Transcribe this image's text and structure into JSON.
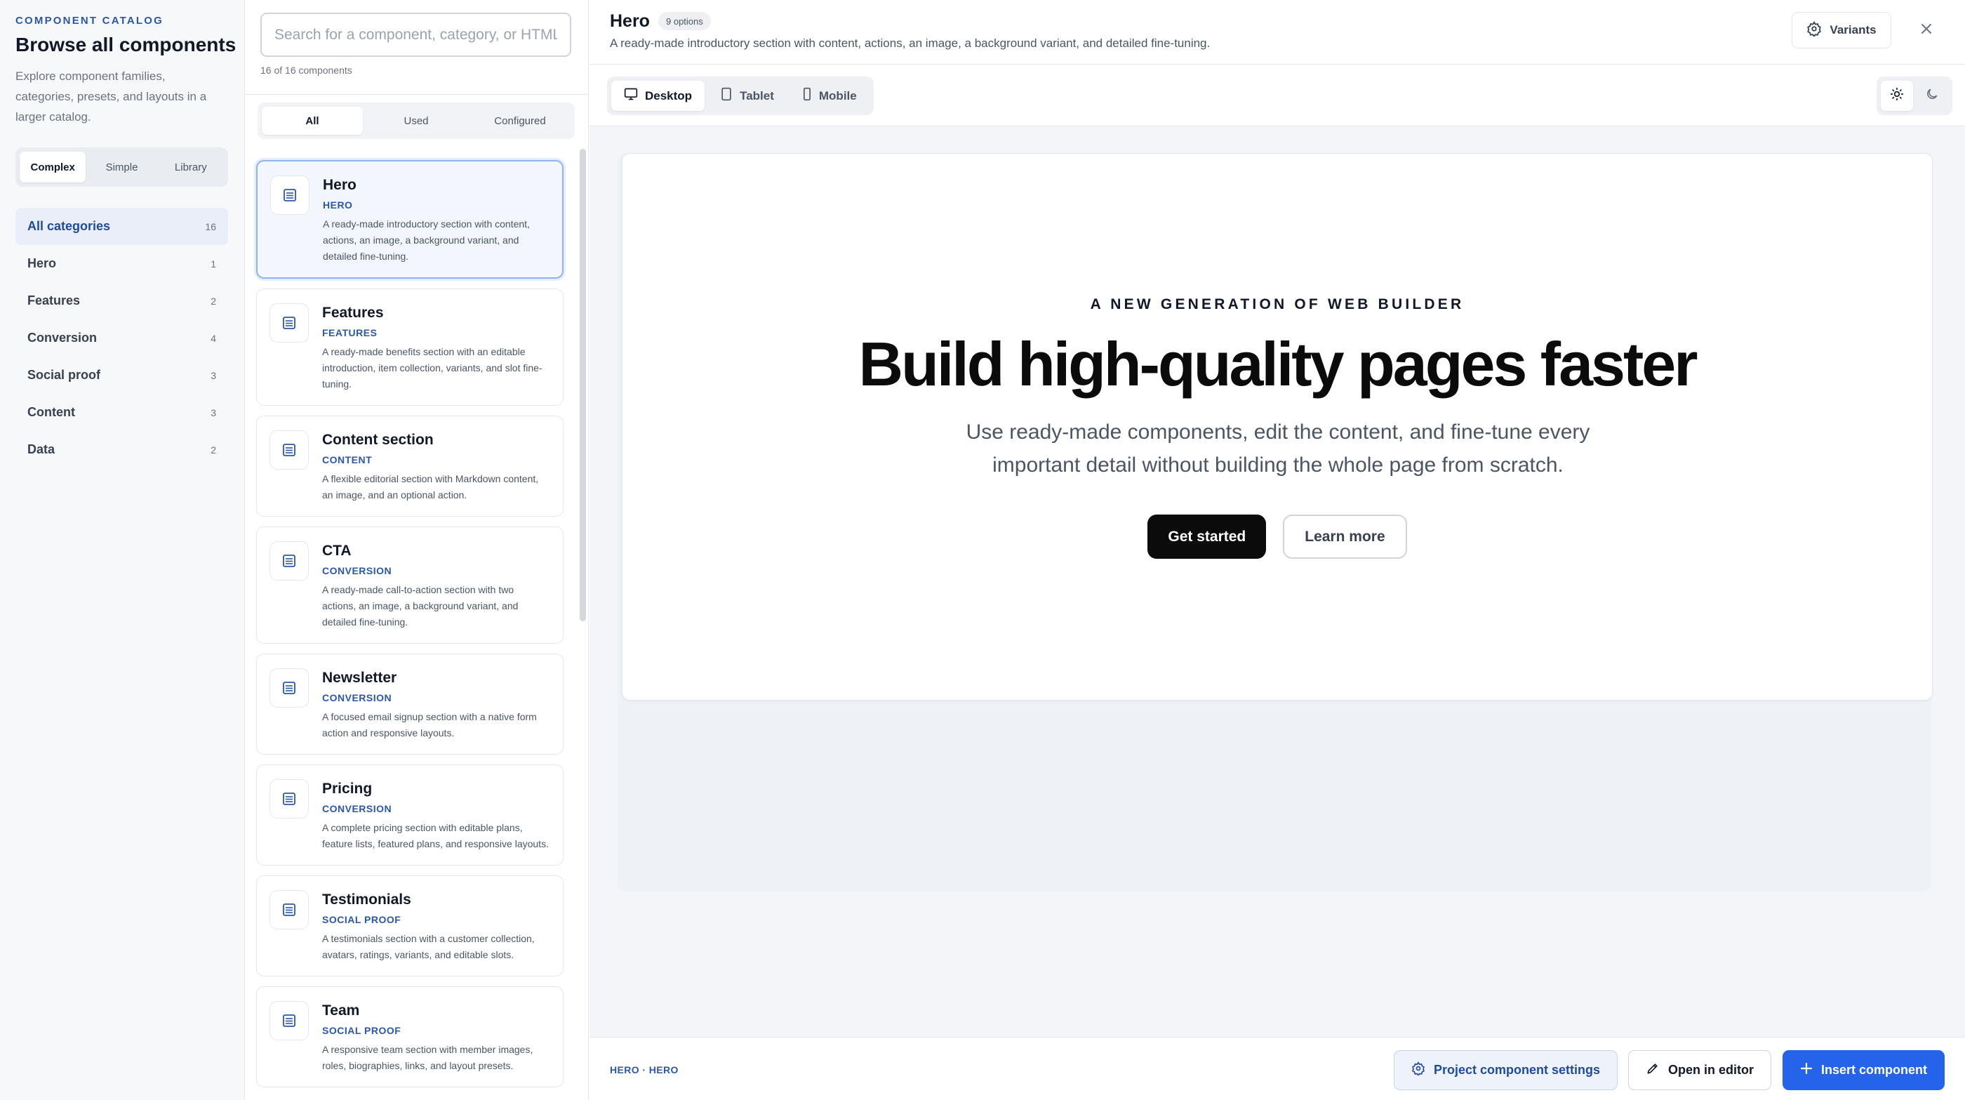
{
  "sidebar": {
    "eyebrow": "COMPONENT CATALOG",
    "title": "Browse all components",
    "description": "Explore component families, categories, presets, and layouts in a larger catalog.",
    "modes": [
      "Complex",
      "Simple",
      "Library"
    ],
    "active_mode": "Complex",
    "categories": [
      {
        "label": "All categories",
        "count": "16",
        "active": true
      },
      {
        "label": "Hero",
        "count": "1"
      },
      {
        "label": "Features",
        "count": "2"
      },
      {
        "label": "Conversion",
        "count": "4"
      },
      {
        "label": "Social proof",
        "count": "3"
      },
      {
        "label": "Content",
        "count": "3"
      },
      {
        "label": "Data",
        "count": "2"
      }
    ]
  },
  "list": {
    "search_placeholder": "Search for a component, category, or HTML tag",
    "search_value": "",
    "count_text": "16 of 16 components",
    "filters": [
      "All",
      "Used",
      "Configured"
    ],
    "active_filter": "All",
    "components": [
      {
        "name": "Hero",
        "tag": "HERO",
        "desc": "A ready-made introductory section with content, actions, an image, a background variant, and detailed fine-tuning.",
        "active": true
      },
      {
        "name": "Features",
        "tag": "FEATURES",
        "desc": "A ready-made benefits section with an editable introduction, item collection, variants, and slot fine-tuning."
      },
      {
        "name": "Content section",
        "tag": "CONTENT",
        "desc": "A flexible editorial section with Markdown content, an image, and an optional action."
      },
      {
        "name": "CTA",
        "tag": "CONVERSION",
        "desc": "A ready-made call-to-action section with two actions, an image, a background variant, and detailed fine-tuning."
      },
      {
        "name": "Newsletter",
        "tag": "CONVERSION",
        "desc": "A focused email signup section with a native form action and responsive layouts."
      },
      {
        "name": "Pricing",
        "tag": "CONVERSION",
        "desc": "A complete pricing section with editable plans, feature lists, featured plans, and responsive layouts."
      },
      {
        "name": "Testimonials",
        "tag": "SOCIAL PROOF",
        "desc": "A testimonials section with a customer collection, avatars, ratings, variants, and editable slots."
      },
      {
        "name": "Team",
        "tag": "SOCIAL PROOF",
        "desc": "A responsive team section with member images, roles, biographies, links, and layout presets."
      }
    ]
  },
  "detail": {
    "title": "Hero",
    "badge": "9 options",
    "description": "A ready-made introductory section with content, actions, an image, a background variant, and detailed fine-tuning.",
    "variants_label": "Variants",
    "devices": [
      "Desktop",
      "Tablet",
      "Mobile"
    ],
    "active_device": "Desktop",
    "theme": "light"
  },
  "preview": {
    "eyebrow": "A NEW GENERATION OF WEB BUILDER",
    "title": "Build high-quality pages faster",
    "subtitle": "Use ready-made components, edit the content, and fine-tune every important detail without building the whole page from scratch.",
    "primary": "Get started",
    "secondary": "Learn more"
  },
  "footer": {
    "breadcrumb": "HERO · HERO",
    "settings": "Project component settings",
    "editor": "Open in editor",
    "insert": "Insert component"
  },
  "colors": {
    "accent": "#2563eb",
    "tag_blue": "#2b57a9"
  }
}
